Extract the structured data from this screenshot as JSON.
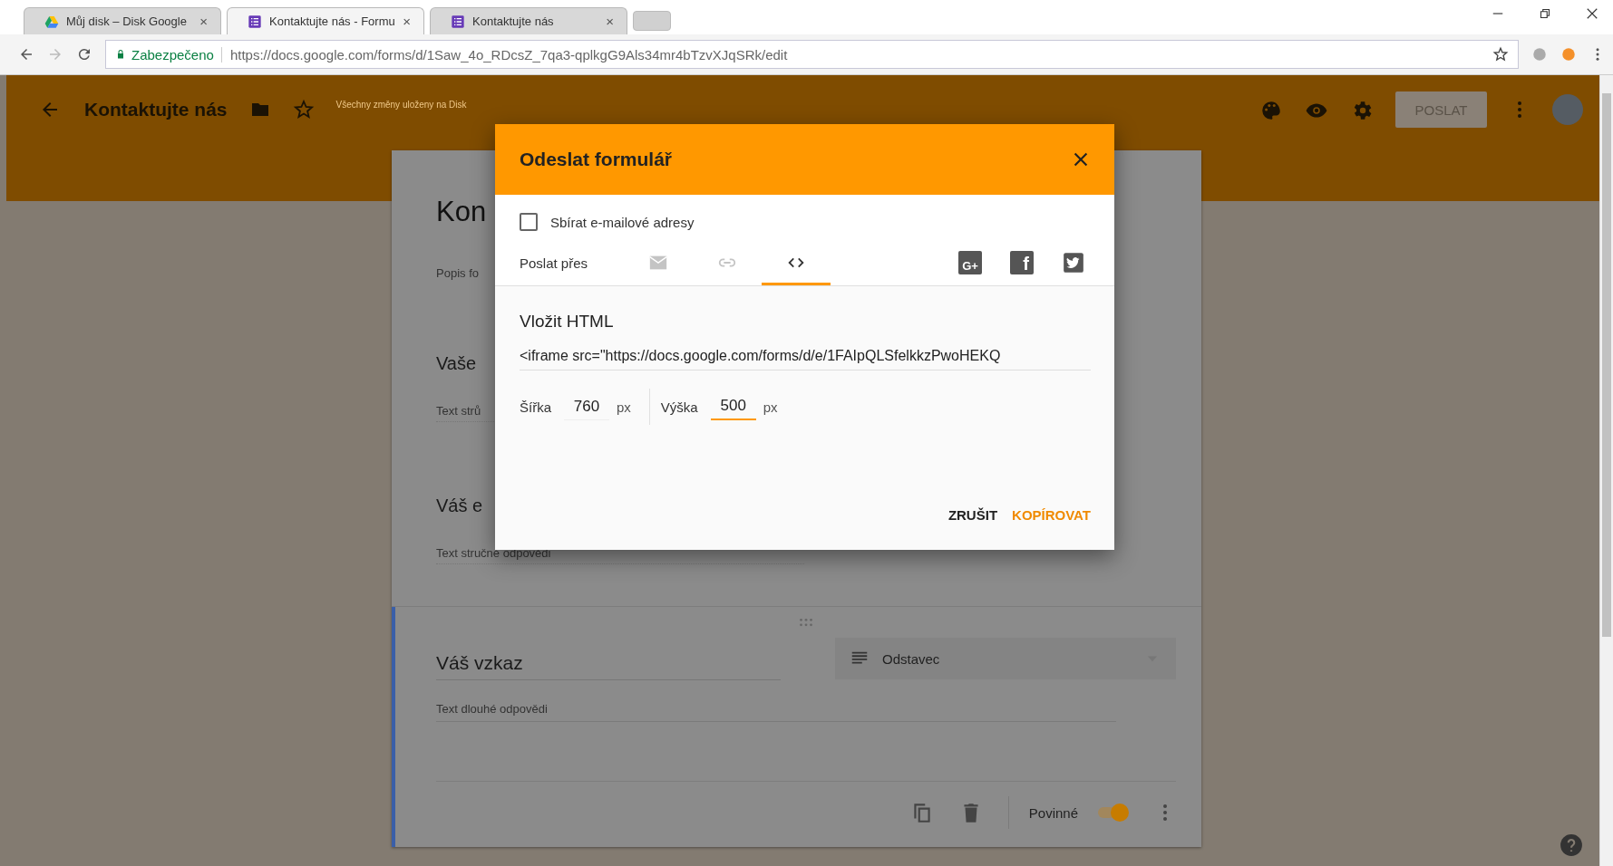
{
  "browser": {
    "tabs": [
      {
        "title": "Můj disk – Disk Google",
        "kind": "drive",
        "close": "×",
        "selected": false
      },
      {
        "title": "Kontaktujte nás - Formu",
        "kind": "forms",
        "close": "×",
        "selected": true
      },
      {
        "title": "Kontaktujte nás",
        "kind": "forms",
        "close": "×",
        "selected": false
      }
    ],
    "security": "Zabezpečeno",
    "url": "https://docs.google.com/forms/d/1Saw_4o_RDcsZ_7qa3-qplkgG9Als34mr4bTzvXJqSRk/edit"
  },
  "app_header": {
    "title": "Kontaktujte nás",
    "save_status": "Všechny změny uloženy na Disk",
    "send_button": "POSLAT"
  },
  "form": {
    "title": "Kon",
    "description": "Popis fo",
    "questions": [
      {
        "title": "Vaše",
        "answer_placeholder": "Text strů"
      },
      {
        "title": "Váš e",
        "answer_placeholder": "Text stručné odpovědi"
      }
    ],
    "active_question": {
      "title": "Váš vzkaz",
      "type": "Odstavec",
      "answer_placeholder": "Text dlouhé odpovědi",
      "required_label": "Povinné",
      "required": true
    }
  },
  "dialog": {
    "title": "Odeslat formulář",
    "collect_emails": {
      "label": "Sbírat e-mailové adresy",
      "checked": false
    },
    "send_via_label": "Poslat přes",
    "send_tabs": [
      {
        "kind": "email",
        "selected": false
      },
      {
        "kind": "link",
        "selected": false
      },
      {
        "kind": "embed",
        "selected": true
      }
    ],
    "share": [
      {
        "kind": "gplus",
        "glyph": "G+"
      },
      {
        "kind": "facebook",
        "glyph": "f"
      },
      {
        "kind": "twitter"
      }
    ],
    "section_title": "Vložit HTML",
    "embed_code": "<iframe src=\"https://docs.google.com/forms/d/e/1FAIpQLSfelkkzPwoHEKQ",
    "width": {
      "label": "Šířka",
      "value": "760",
      "unit": "px",
      "focused": false
    },
    "height": {
      "label": "Výška",
      "value": "500",
      "unit": "px",
      "focused": true
    },
    "buttons": [
      {
        "label": "ZRUŠIT",
        "kind": "cancel"
      },
      {
        "label": "KOPÍROVAT",
        "kind": "primary"
      }
    ]
  }
}
